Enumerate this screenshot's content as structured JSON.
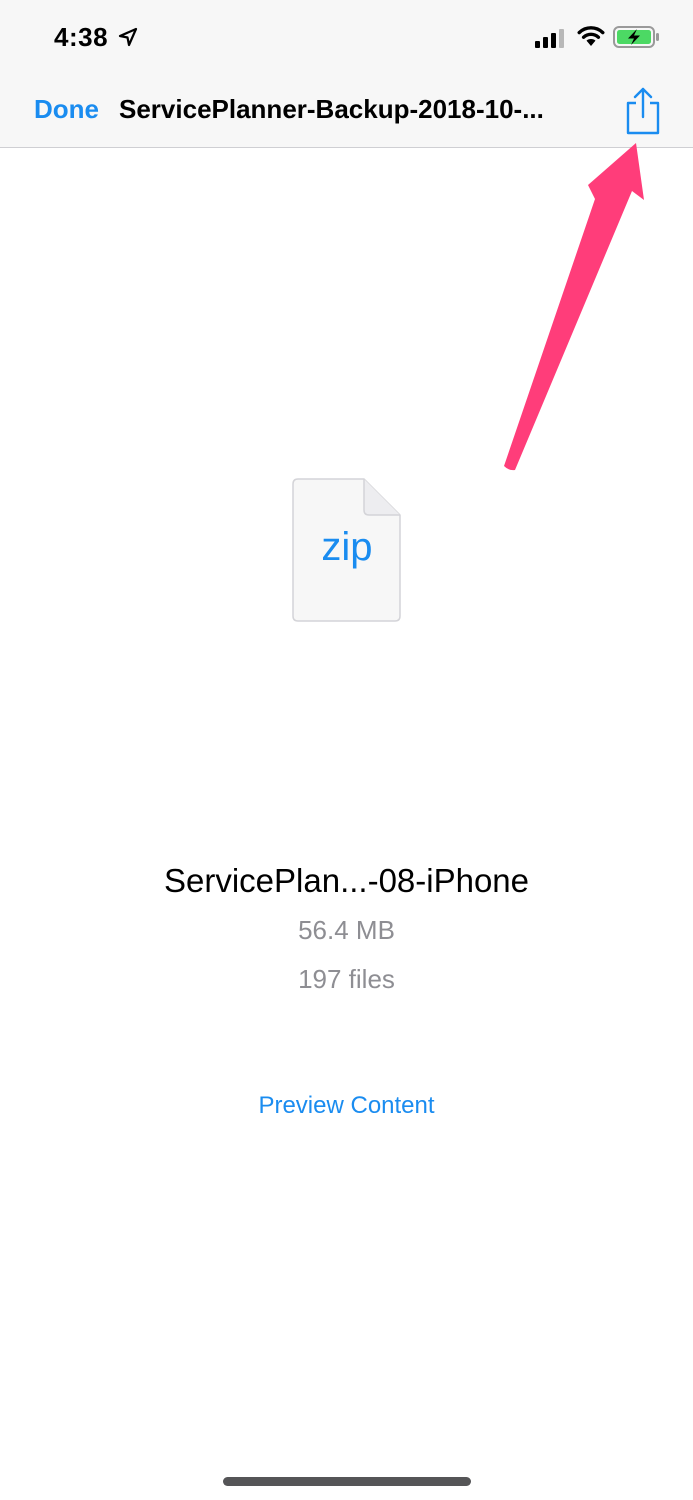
{
  "status_bar": {
    "time": "4:38",
    "icons": [
      "location-arrow-icon",
      "cellular-signal-icon",
      "wifi-icon",
      "battery-charging-icon"
    ]
  },
  "nav_bar": {
    "done_label": "Done",
    "title": "ServicePlanner-Backup-2018-10-...",
    "share_icon": "share-icon"
  },
  "file": {
    "type_label": "zip",
    "name": "ServicePlan...-08-iPhone",
    "size": "56.4 MB",
    "count": "197 files"
  },
  "actions": {
    "preview_label": "Preview Content"
  },
  "colors": {
    "accent": "#1a8cf0",
    "annotation_arrow": "#ff3d7a",
    "battery_fill": "#4cd964",
    "secondary_text": "#8e8e93"
  }
}
